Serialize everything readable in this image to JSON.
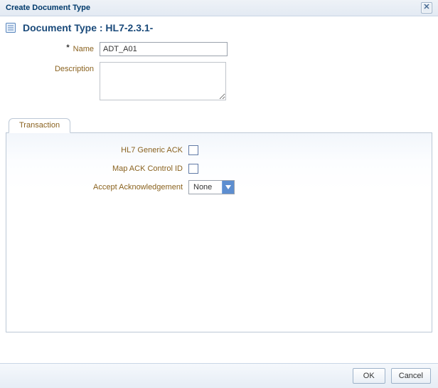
{
  "window": {
    "title": "Create Document Type"
  },
  "page": {
    "heading": "Document Type : HL7-2.3.1-"
  },
  "form": {
    "name_label": "Name",
    "name_value": "ADT_A01",
    "description_label": "Description",
    "description_value": ""
  },
  "tabs": {
    "transaction_label": "Transaction"
  },
  "transaction": {
    "hl7_generic_ack_label": "HL7 Generic ACK",
    "hl7_generic_ack_checked": false,
    "map_ack_control_id_label": "Map ACK Control ID",
    "map_ack_control_id_checked": false,
    "accept_ack_label": "Accept Acknowledgement",
    "accept_ack_value": "None"
  },
  "footer": {
    "ok": "OK",
    "cancel": "Cancel"
  }
}
